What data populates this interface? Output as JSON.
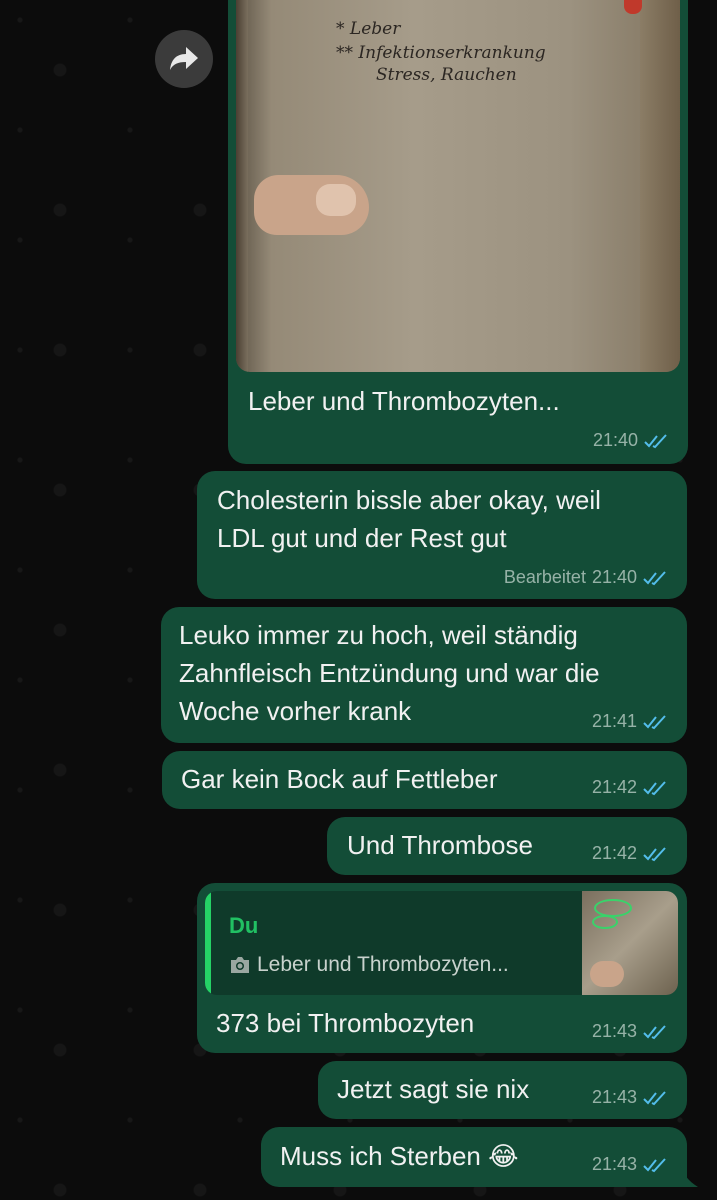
{
  "colors": {
    "bubble": "#134d37",
    "quote_bg": "#0f3a2a",
    "quote_accent": "#25d366",
    "read_ticks": "#53bdeb"
  },
  "icons": {
    "forward": "forward-arrow-icon",
    "ticks": "double-check-icon",
    "camera": "camera-icon"
  },
  "photo_note": {
    "line1": "* Leber",
    "line2": "** Infektionserkrankung",
    "line3": "Stress, Rauchen"
  },
  "messages": [
    {
      "text": "Leber und Thrombozyten...",
      "time": "21:40"
    },
    {
      "line1": "Cholesterin bissle aber okay, weil",
      "line2": "LDL gut und der Rest gut",
      "edited": "Bearbeitet",
      "time": "21:40"
    },
    {
      "line1": "Leuko immer zu hoch, weil ständig",
      "line2": "Zahnfleisch Entzündung und war die",
      "line3": "Woche vorher krank",
      "time": "21:41"
    },
    {
      "text": "Gar kein Bock auf Fettleber",
      "time": "21:42"
    },
    {
      "text": "Und Thrombose",
      "time": "21:42"
    },
    {
      "quote_author": "Du",
      "quote_text": "Leber und Thrombozyten...",
      "text": "373 bei Thrombozyten",
      "time": "21:43"
    },
    {
      "text": "Jetzt sagt sie nix",
      "time": "21:43"
    },
    {
      "text": "Muss ich Sterben 😂",
      "time": "21:43"
    }
  ]
}
